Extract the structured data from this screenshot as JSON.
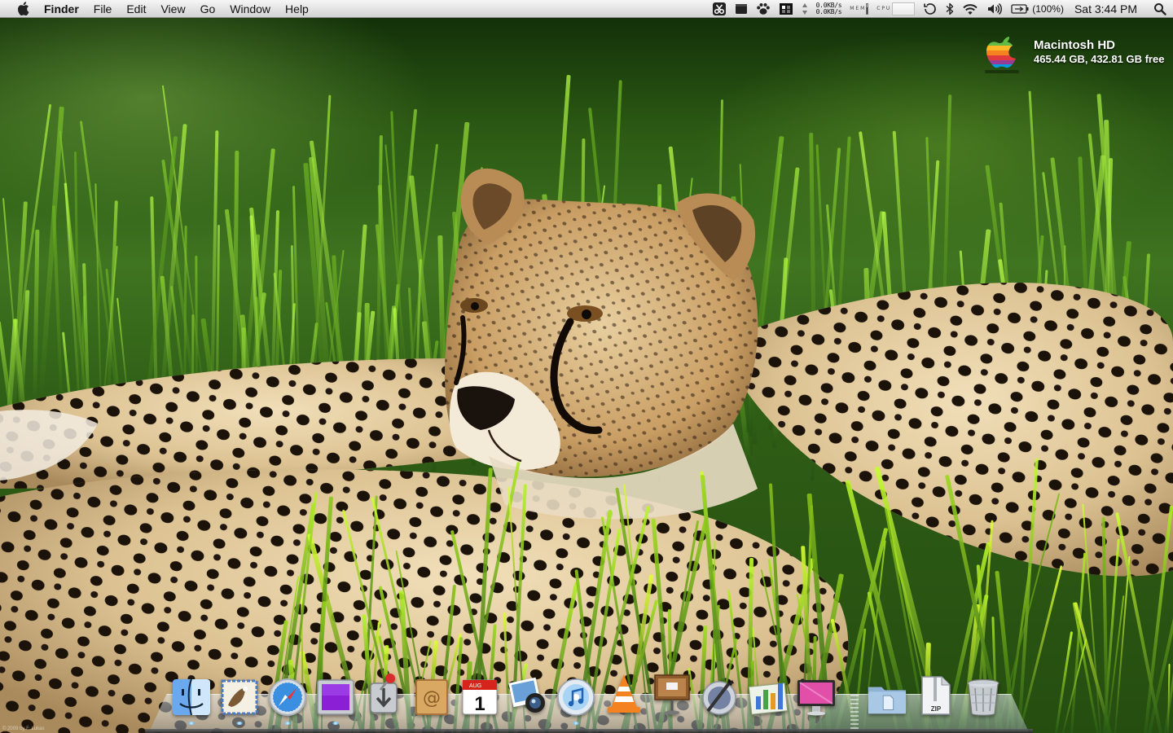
{
  "menubar": {
    "app_name": "Finder",
    "items": [
      "File",
      "Edit",
      "View",
      "Go",
      "Window",
      "Help"
    ],
    "status_icons": [
      "scissors-icon",
      "window-icon",
      "paw-icon",
      "spaces-icon",
      "sort-arrows-icon"
    ],
    "network": {
      "up": "0.0KB/s",
      "down": "0.0KB/s"
    },
    "memory_label": "M E M",
    "cpu_label": "C P U",
    "battery_percent": "(100%)",
    "clock": "Sat 3:44 PM"
  },
  "drive": {
    "name": "Macintosh HD",
    "size": "465.44 GB, 432.81 GB free",
    "fill_fraction": 0.07
  },
  "dock": {
    "apps": [
      {
        "icon": "finder-icon",
        "running": true
      },
      {
        "icon": "mail-icon",
        "running": true
      },
      {
        "icon": "safari-icon",
        "running": true
      },
      {
        "icon": "purple-app-icon",
        "running": true
      },
      {
        "icon": "download-app-icon",
        "running": false
      },
      {
        "icon": "address-book-icon",
        "running": false
      },
      {
        "icon": "ical-icon",
        "running": false,
        "month": "AUG",
        "day": "1"
      },
      {
        "icon": "iphoto-icon",
        "running": false
      },
      {
        "icon": "itunes-icon",
        "running": true
      },
      {
        "icon": "vlc-icon",
        "running": false
      },
      {
        "icon": "keynote-icon",
        "running": false
      },
      {
        "icon": "script-editor-icon",
        "running": false
      },
      {
        "icon": "numbers-icon",
        "running": false
      },
      {
        "icon": "cleanmymac-icon",
        "running": false
      }
    ],
    "stacks": [
      {
        "icon": "documents-folder-icon"
      },
      {
        "icon": "zip-archive-icon",
        "label": "ZIP"
      },
      {
        "icon": "trash-icon"
      }
    ]
  },
  "wallpaper": {
    "credit": "© 2009 by F. Lukas"
  }
}
